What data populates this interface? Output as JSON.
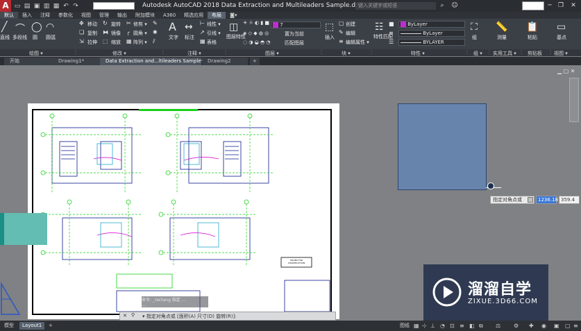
{
  "app": {
    "title": "Autodesk AutoCAD 2018   Data Extraction and Multileaders Sample.dwg",
    "search_placeholder": "键入关键字或短语",
    "logo_letter": "A",
    "login_text": ""
  },
  "menu_tabs": [
    "默认",
    "插入",
    "注释",
    "参数化",
    "视图",
    "管理",
    "输出",
    "附加模块",
    "A360",
    "精选应用",
    "布局",
    "◙▾"
  ],
  "ribbon": {
    "draw": {
      "label": "绘图 ▾",
      "tools": [
        "直线",
        "多段线",
        "圆",
        "圆弧"
      ]
    },
    "modify": {
      "label": "修改 ▾",
      "tools": [
        "移动",
        "旋转",
        "修剪 ▾",
        "复制",
        "镜像",
        "圆角 ▾",
        "拉伸",
        "缩放",
        "阵列 ▾"
      ]
    },
    "annotation": {
      "label": "注释 ▾",
      "tools": [
        "文字",
        "标注",
        "线性 ▾",
        "引线 ▾",
        "表格"
      ]
    },
    "layers": {
      "label": "图层 ▾",
      "tools": [
        "图层特性",
        "置为当前",
        "匹配图层"
      ],
      "current_layer": "7"
    },
    "block": {
      "label": "块 ▾",
      "tools": [
        "插入",
        "创建",
        "编辑",
        "编辑属性 ▾"
      ]
    },
    "properties": {
      "label": "特性 ▾",
      "tools": [
        "特性匹配"
      ],
      "color": "ByLayer",
      "linetype": "ByLayer",
      "lineweight": "BYLAYER",
      "color_swatch": "#c22ad6"
    },
    "groups": {
      "label": "组 ▾",
      "tools": [
        "组"
      ]
    },
    "utilities": {
      "label": "实用工具 ▾",
      "tools": [
        "测量"
      ]
    },
    "clipboard": {
      "label": "剪贴板",
      "tools": [
        "粘贴"
      ]
    },
    "view": {
      "label": "视图 ▾",
      "tools": [
        "基点"
      ]
    }
  },
  "doc_tabs": [
    "开始",
    "Drawing1*",
    "Data Extraction and...ltileaders Sample*",
    "Drawing2",
    "+"
  ],
  "active_doc_tab": 2,
  "drawing": {
    "sheet_stamp": "ISSUED FOR\nCONSTRUCTION",
    "dynamic_prompt": "指定对角点或",
    "dyn_x": "1236.18",
    "dyn_y": "359.4"
  },
  "command": {
    "history": [
      "命令: _rectang 指定 ...",
      "..."
    ],
    "prompt": "▾ 指定对角点或 [面积(A) 尺寸(D) 旋转(R)]:",
    "close_icon": "✕"
  },
  "status": {
    "layout_tabs": [
      "模型",
      "Layout1",
      "+"
    ],
    "active_layout": 1,
    "paper_label": "图纸"
  },
  "watermark": {
    "brand": "溜溜自学",
    "url": "ZIXUE.3D66.COM"
  }
}
